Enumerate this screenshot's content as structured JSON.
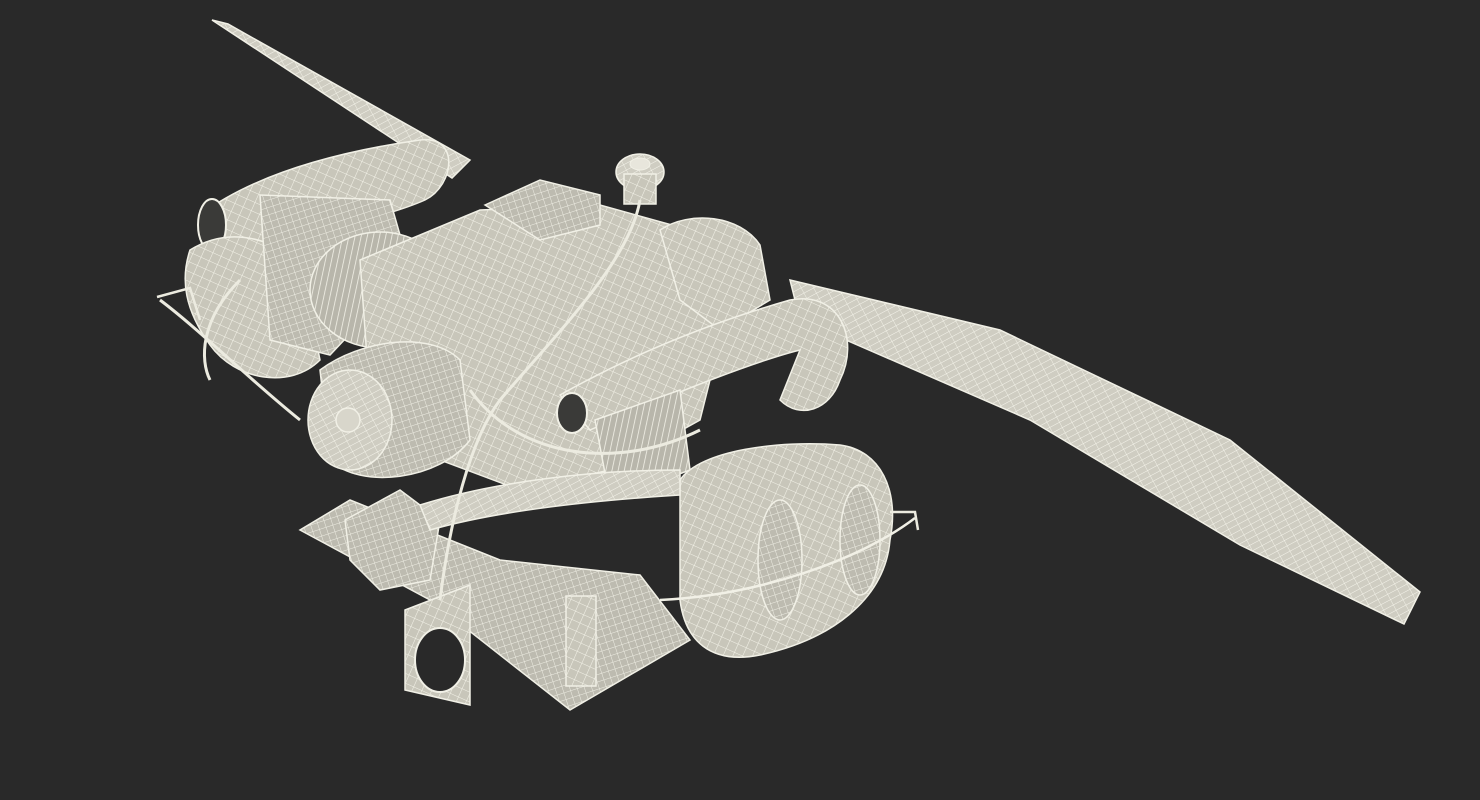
{
  "scene": {
    "background_color": "#292929",
    "model_color": "#c9c7bc",
    "wire_color": "#f1f0e6",
    "shadow_color": "#8c8a80"
  }
}
